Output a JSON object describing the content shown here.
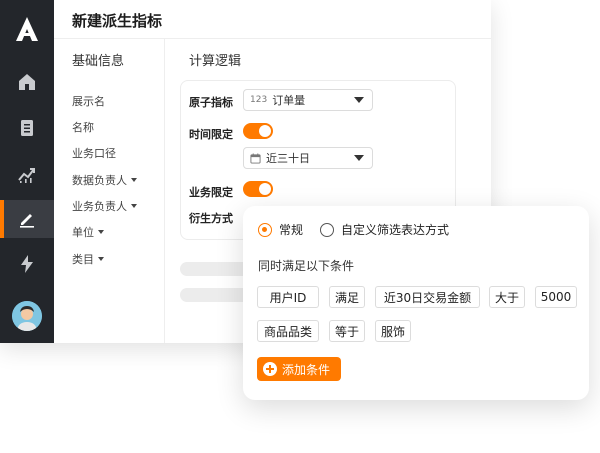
{
  "window": {
    "title": "新建派生指标"
  },
  "sidebar": {
    "nav": [
      {
        "icon": "home-icon"
      },
      {
        "icon": "document-icon"
      },
      {
        "icon": "trend-icon"
      },
      {
        "icon": "edit-icon",
        "active": true
      },
      {
        "icon": "lightning-icon"
      }
    ]
  },
  "basic": {
    "heading": "基础信息",
    "fields": [
      "展示名",
      "名称",
      "业务口径",
      "数据负责人",
      "业务负责人",
      "单位",
      "类目"
    ]
  },
  "logic": {
    "heading": "计算逻辑",
    "atomic_label": "原子指标",
    "atomic_prefix": "123",
    "atomic_value": "订单量",
    "time_label": "时间限定",
    "time_value": "近三十日",
    "biz_label": "业务限定",
    "derive_label": "衍生方式"
  },
  "popup": {
    "radio_normal": "常规",
    "radio_custom": "自定义筛选表达方式",
    "cond_title": "同时满足以下条件",
    "row1": [
      "用户ID",
      "满足",
      "近30日交易金额",
      "大于",
      "5000"
    ],
    "row2": [
      "商品品类",
      "等于",
      "服饰"
    ],
    "add_label": "添加条件"
  },
  "colors": {
    "accent": "#ff7a00",
    "sidebar": "#23262b"
  }
}
